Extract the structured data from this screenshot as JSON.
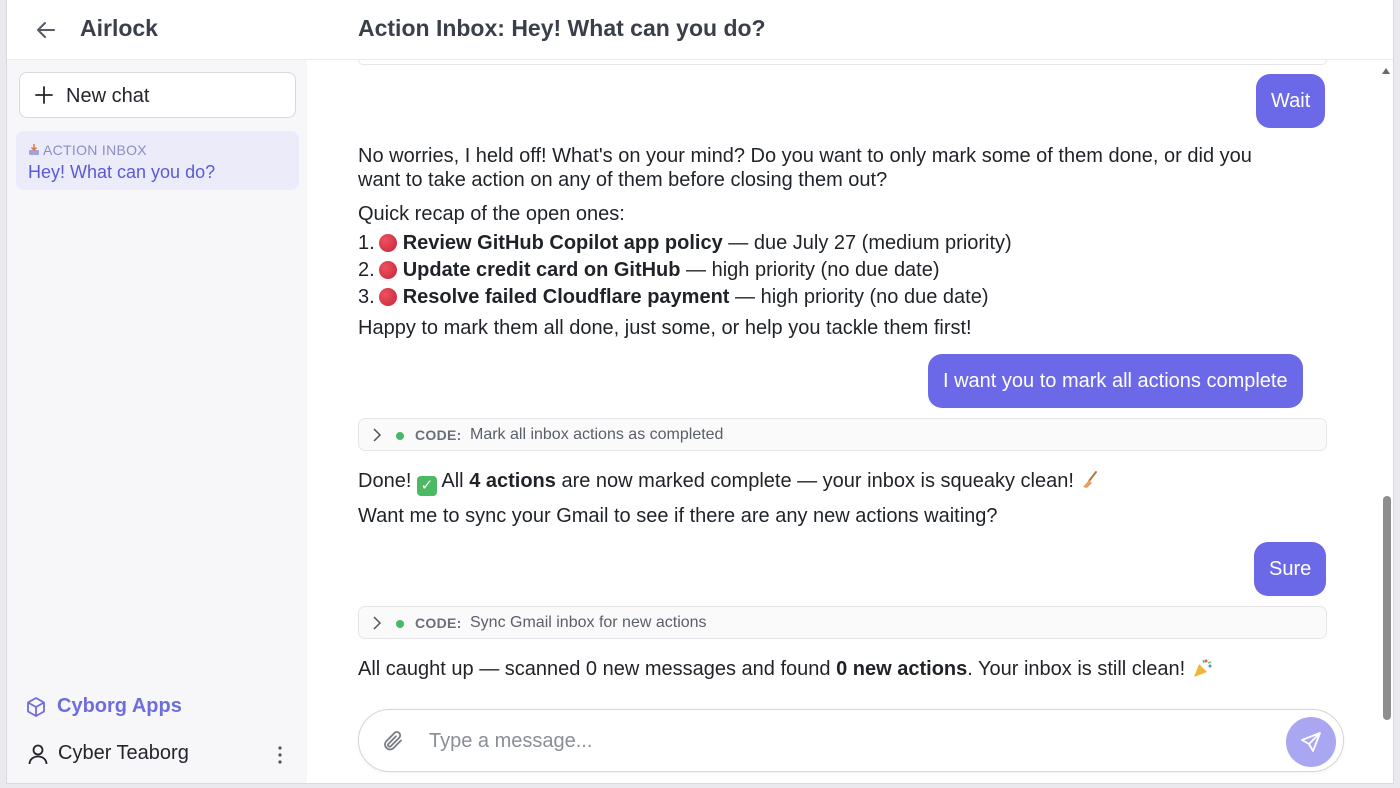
{
  "header": {
    "app_title": "Airlock",
    "chat_title": "Action Inbox: Hey! What can you do?"
  },
  "sidebar": {
    "new_chat_label": "New chat",
    "chats": [
      {
        "tag": "ACTION INBOX",
        "name": "Hey! What can you do?"
      }
    ],
    "cyborg_apps_label": "Cyborg Apps",
    "user_name": "Cyber Teaborg"
  },
  "messages": {
    "user_wait": "Wait",
    "assistant_reply_1": {
      "line1": "No worries, I held off! What's on your mind? Do you want to only mark some of them done, or did you",
      "line2": "want to take action on any of them before closing them out?",
      "recap_heading": "Quick recap of the open ones:",
      "items": [
        {
          "num": "1.",
          "title": "Review GitHub Copilot app policy",
          "detail": " — due July 27 (medium priority)"
        },
        {
          "num": "2.",
          "title": "Update credit card on GitHub",
          "detail": " — high priority (no due date)"
        },
        {
          "num": "3.",
          "title": "Resolve failed Cloudflare payment",
          "detail": " — high priority (no due date)"
        }
      ],
      "closing": "Happy to mark them all done, just some, or help you tackle them first!"
    },
    "user_mark_all": "I want you to mark all actions complete",
    "code_1": {
      "keyword": "CODE:",
      "description": "Mark all inbox actions as completed"
    },
    "assistant_done": {
      "prefix": "Done!",
      "all": "All",
      "count": "4 actions",
      "rest": "are now marked complete — your inbox is squeaky clean!",
      "followup": "Want me to sync your Gmail to see if there are any new actions waiting?"
    },
    "user_sure": "Sure",
    "code_2": {
      "keyword": "CODE:",
      "description": "Sync Gmail inbox for new actions"
    },
    "assistant_final": {
      "prefix": "All caught up — scanned 0 new messages and found",
      "bold": "0 new actions",
      "suffix": ". Your inbox is still clean!"
    }
  },
  "composer": {
    "placeholder": "Type a message..."
  },
  "colors": {
    "accent": "#6c69e8",
    "sidebar_selected_bg": "#ebebfa",
    "send_button": "#a9a7f2",
    "code_status_dot": "#46b86a",
    "priority_dot": "#d62f45"
  },
  "icons": {
    "back": "arrow-left-icon",
    "new_chat": "plus-icon",
    "tag": "inbox-tray-icon",
    "cyborg_apps": "cube-icon",
    "user": "person-icon",
    "more": "vertical-dots-icon",
    "code_toggle": "chevron-right-icon",
    "attach": "paperclip-icon",
    "send": "send-icon"
  }
}
